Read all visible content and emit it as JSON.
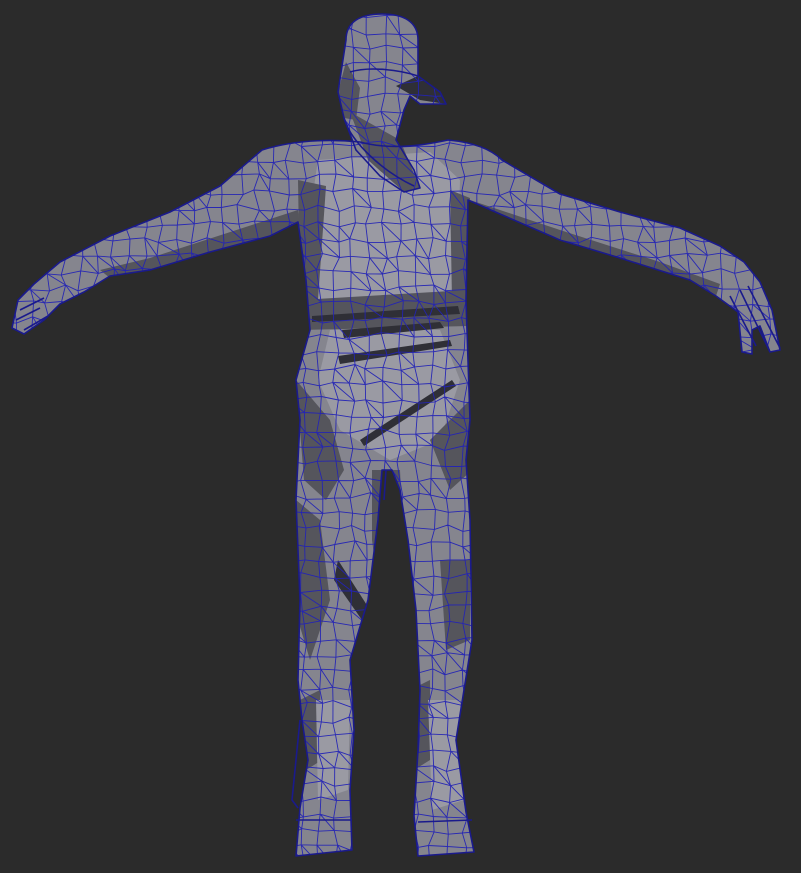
{
  "viewport": {
    "background_color": "#2b2b2b",
    "mesh_fill_color": "#85858e",
    "wireframe_color": "#2323b5"
  }
}
